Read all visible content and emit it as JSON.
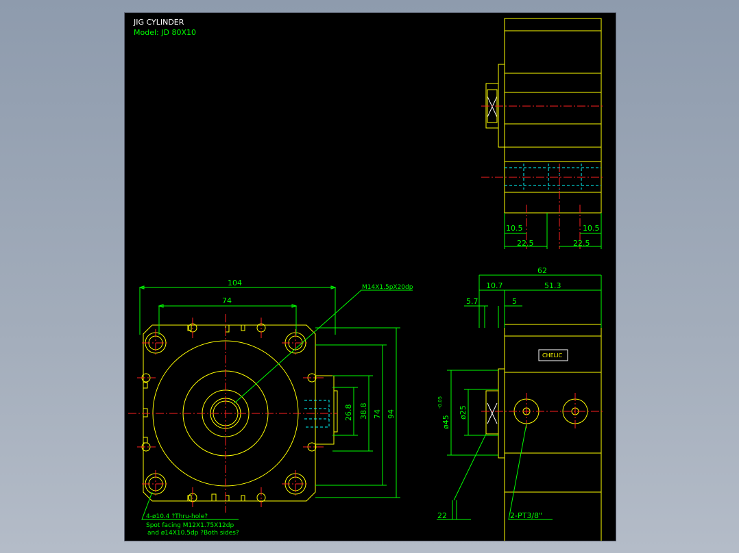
{
  "title": {
    "name": "JIG CYLINDER",
    "model": "Model: JD 80X10"
  },
  "front_view": {
    "dims": {
      "width_overall": "104",
      "bolt_pitch_h": "74",
      "d1": "26.8",
      "d2": "38.8",
      "d3": "74",
      "height_overall": "94"
    },
    "thread_callout": "M14X1.5pX20dp",
    "note": {
      "line1": "4-ø10.4 ?Thru-hole?",
      "line2": "Spot facing  M12X1.75X12dp",
      "line3": "and ø14X10.5dp ?Both sides?"
    }
  },
  "top_view": {
    "dims": {
      "left_small": "10.5",
      "right_small": "10.5",
      "left_large": "22.5",
      "right_large": "22.5"
    }
  },
  "side_view": {
    "dims": {
      "overall": "62",
      "head": "10.7",
      "body": "51.3",
      "a": "5.7",
      "b": "5",
      "dia_rod": "ø25",
      "dia_bore": "ø45",
      "tol": "-0.05",
      "rod_len": "22"
    },
    "port_callout": "2-PT3/8\"",
    "brand": "CHELIC"
  },
  "colors": {
    "outline": "#ffff00",
    "dimension": "#00ff00",
    "centerline": "#ff2020",
    "hidden": "#00ffff",
    "title_text": "#ffffff"
  }
}
